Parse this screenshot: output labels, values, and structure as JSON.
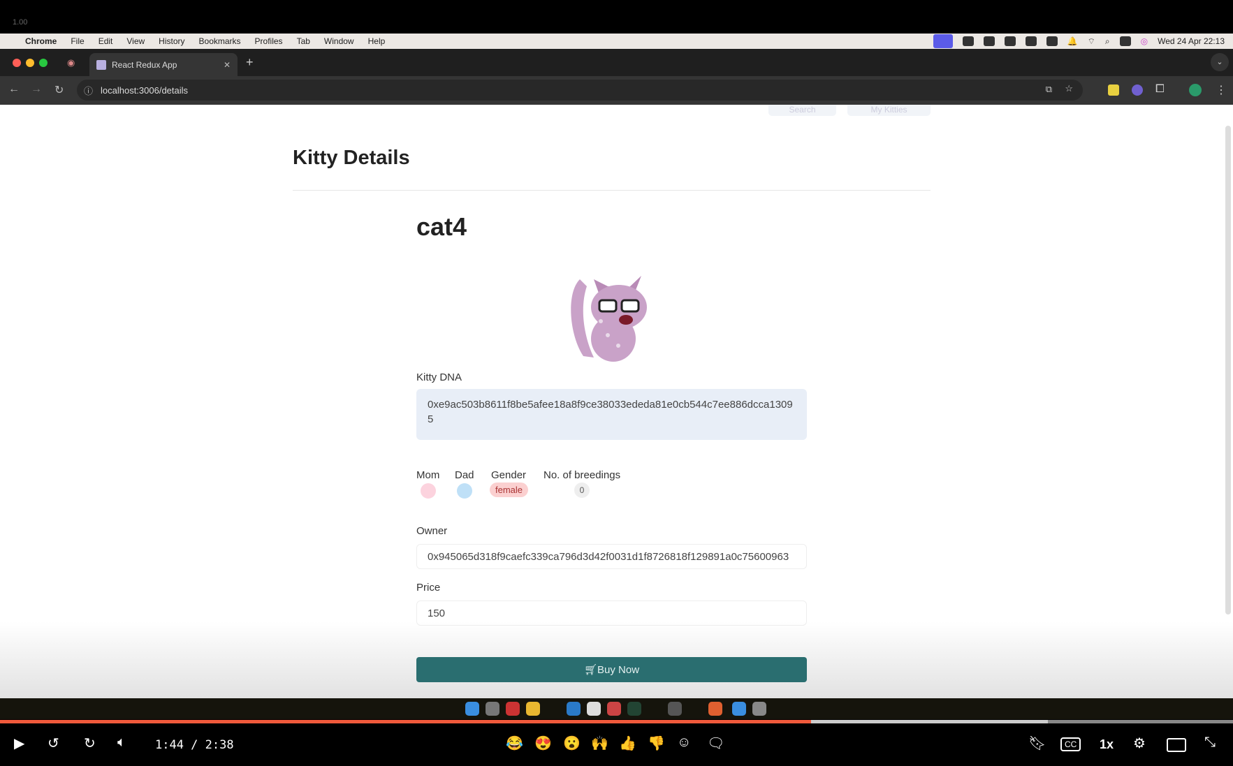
{
  "video_overlay": {
    "speed_label": "1.00",
    "time": "1:44 / 2:38",
    "progress": 0.658,
    "buffered": 0.85,
    "speed": "1x",
    "reactions": [
      "😂",
      "😍",
      "😮",
      "🙌",
      "👍",
      "👎"
    ],
    "accent": "#f05a3c"
  },
  "menubar": {
    "app": "Chrome",
    "items": [
      "File",
      "Edit",
      "View",
      "History",
      "Bookmarks",
      "Profiles",
      "Tab",
      "Window",
      "Help"
    ],
    "datetime": "Wed 24 Apr  22:13"
  },
  "browser": {
    "tab_title": "React Redux App",
    "url": "localhost:3006/details"
  },
  "header": {
    "nav_buttons": [
      "Search",
      "My Kitties"
    ]
  },
  "page": {
    "title": "Kitty Details",
    "kitty_name": "cat4",
    "dna_label": "Kitty DNA",
    "dna_value": "0xe9ac503b8611f8be5afee18a8f9ce38033ededa81e0cb544c7ee886dcca13095",
    "stats": {
      "mom_label": "Mom",
      "dad_label": "Dad",
      "gender_label": "Gender",
      "gender_value": "female",
      "breedings_label": "No. of breedings",
      "breedings_value": "0"
    },
    "owner_label": "Owner",
    "owner_value": "0x945065d318f9caefc339ca796d3d42f0031d1f8726818f129891a0c75600963",
    "price_label": "Price",
    "price_value": "150",
    "buy_label": "Buy Now",
    "colors": {
      "button": "#2a6e70",
      "mom": "#fcd3de",
      "dad": "#bfe0f7",
      "gender_badge": "#fbd0d0"
    }
  }
}
